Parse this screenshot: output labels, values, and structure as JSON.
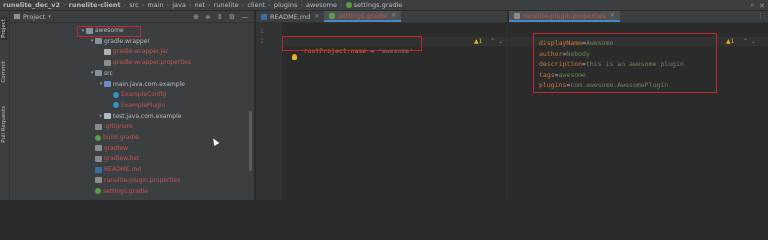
{
  "breadcrumb": [
    "runelite_dec_v2",
    "runelite-client",
    "src",
    "main",
    "java",
    "net",
    "runelite",
    "client",
    "plugins",
    "awesome",
    "settings.gradle"
  ],
  "project_panel": {
    "title": "Project",
    "side_tabs": [
      "Project",
      "Commit",
      "Pull Requests"
    ],
    "tree": [
      {
        "label": "awesome",
        "depth": 0,
        "arrow": "▾",
        "icon": "folder",
        "style": "normal"
      },
      {
        "label": "gradle.wrapper",
        "depth": 1,
        "arrow": "▾",
        "icon": "folder",
        "style": "normal"
      },
      {
        "label": "gradle-wrapper.jar",
        "depth": 2,
        "arrow": "",
        "icon": "file-j",
        "style": "red"
      },
      {
        "label": "gradle-wrapper.properties",
        "depth": 2,
        "arrow": "",
        "icon": "file-p",
        "style": "red"
      },
      {
        "label": "src",
        "depth": 1,
        "arrow": "▾",
        "icon": "folder",
        "style": "normal"
      },
      {
        "label": "main.java.com.example",
        "depth": 2,
        "arrow": "▾",
        "icon": "folder-src",
        "style": "normal"
      },
      {
        "label": "ExampleConfig",
        "depth": 3,
        "arrow": "",
        "icon": "file-c",
        "style": "red"
      },
      {
        "label": "ExamplePlugin",
        "depth": 3,
        "arrow": "",
        "icon": "file-c",
        "style": "red"
      },
      {
        "label": "test.java.com.example",
        "depth": 2,
        "arrow": "▸",
        "icon": "folder-pkg",
        "style": "normal"
      },
      {
        "label": ".gitignore",
        "depth": 1,
        "arrow": "",
        "icon": "file-p",
        "style": "red"
      },
      {
        "label": "build.gradle",
        "depth": 1,
        "arrow": "",
        "icon": "file-g",
        "style": "red"
      },
      {
        "label": "gradlew",
        "depth": 1,
        "arrow": "",
        "icon": "file-p",
        "style": "red"
      },
      {
        "label": "gradlew.bat",
        "depth": 1,
        "arrow": "",
        "icon": "file-p",
        "style": "red"
      },
      {
        "label": "README.md",
        "depth": 1,
        "arrow": "",
        "icon": "file-md",
        "style": "red"
      },
      {
        "label": "runelite-plugin.properties",
        "depth": 1,
        "arrow": "",
        "icon": "file-p",
        "style": "red"
      },
      {
        "label": "settings.gradle",
        "depth": 1,
        "arrow": "",
        "icon": "file-g",
        "style": "red"
      }
    ]
  },
  "editor_left": {
    "tabs": [
      {
        "label": "README.md",
        "active": false
      },
      {
        "label": "settings.gradle",
        "active": true
      }
    ],
    "line_numbers": [
      "1",
      "2"
    ],
    "code_line1": {
      "key": "rootProject.name",
      "eq": " = ",
      "value": "'awesome'"
    },
    "warning_count": "1"
  },
  "editor_right": {
    "tabs": [
      {
        "label": "runelite-plugin.properties",
        "active": true
      }
    ],
    "warning_count": "1",
    "lines": [
      {
        "key": "displayName",
        "value": "Awesome"
      },
      {
        "key": "author",
        "value": "Nobody"
      },
      {
        "key": "description",
        "value": "this is an awesome plugin"
      },
      {
        "key": "tags",
        "value": "awesome"
      },
      {
        "key": "plugins",
        "value": "com.awesome.AwesomePlugin"
      }
    ]
  },
  "colors": {
    "highlight_box": "#c0262d",
    "modified_file": "#c75450",
    "active_tab_underline": "#4a88c7"
  }
}
